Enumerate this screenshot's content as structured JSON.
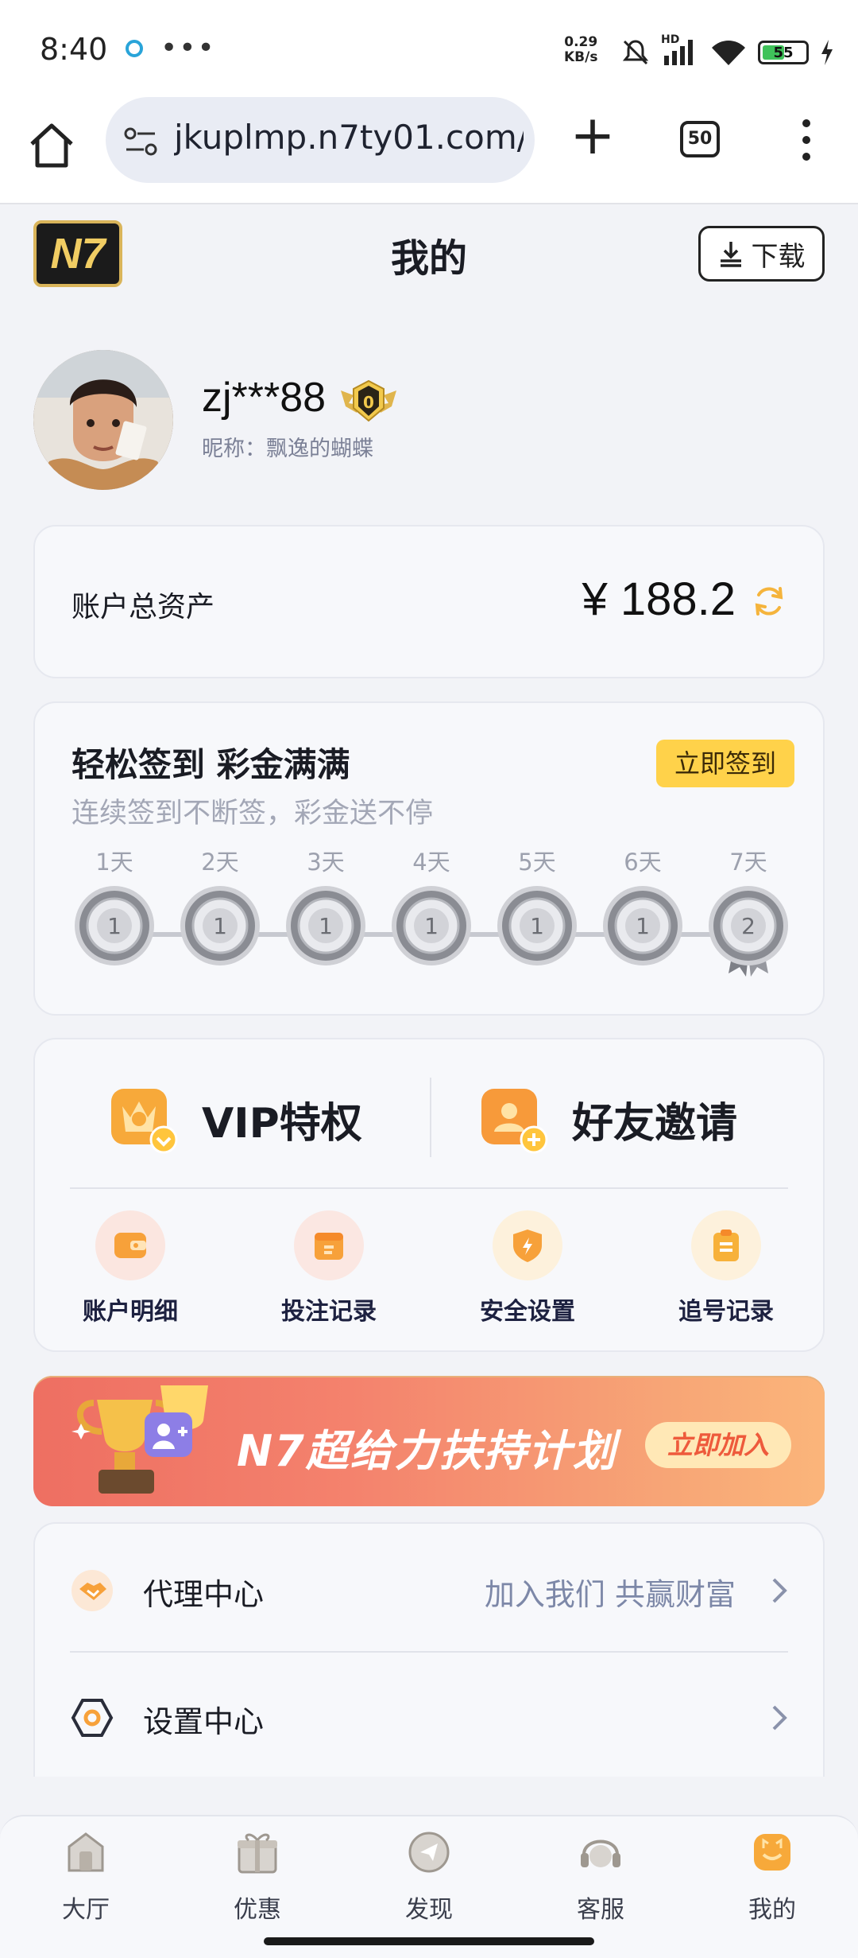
{
  "status_bar": {
    "time": "8:40",
    "more": "•••",
    "net_speed_value": "0.29",
    "net_speed_unit": "KB/s",
    "network_label": "HD",
    "battery": "55"
  },
  "browser": {
    "url": "jkuplmp.n7ty01.com/h",
    "tab_count": "50",
    "new_tab": "+"
  },
  "header": {
    "logo": "N7",
    "title": "我的",
    "download_label": "下载"
  },
  "profile": {
    "username": "zj***88",
    "nickname": "昵称：飘逸的蝴蝶",
    "vip_level": "0"
  },
  "assets": {
    "label": "账户总资产",
    "value": "¥ 188.2"
  },
  "checkin": {
    "title": "轻松签到 彩金满满",
    "subtitle": "连续签到不断签，彩金送不停",
    "button": "立即签到",
    "days": [
      {
        "label": "1天",
        "reward": "1"
      },
      {
        "label": "2天",
        "reward": "1"
      },
      {
        "label": "3天",
        "reward": "1"
      },
      {
        "label": "4天",
        "reward": "1"
      },
      {
        "label": "5天",
        "reward": "1"
      },
      {
        "label": "6天",
        "reward": "1"
      },
      {
        "label": "7天",
        "reward": "2"
      }
    ]
  },
  "menu": {
    "vip": "VIP特权",
    "invite": "好友邀请",
    "items": [
      {
        "label": "账户明细",
        "icon": "wallet-icon"
      },
      {
        "label": "投注记录",
        "icon": "calendar-icon"
      },
      {
        "label": "安全设置",
        "icon": "shield-icon"
      },
      {
        "label": "追号记录",
        "icon": "clipboard-icon"
      }
    ]
  },
  "banner": {
    "title": "N7超给力扶持计划",
    "button": "立即加入"
  },
  "list": {
    "agent_label": "代理中心",
    "agent_extra": "加入我们 共赢财富",
    "settings_label": "设置中心"
  },
  "nav": [
    {
      "label": "大厅",
      "icon": "lobby-icon"
    },
    {
      "label": "优惠",
      "icon": "gift-icon"
    },
    {
      "label": "发现",
      "icon": "discover-icon"
    },
    {
      "label": "客服",
      "icon": "headset-icon"
    },
    {
      "label": "我的",
      "icon": "profile-icon"
    }
  ],
  "colors": {
    "accent": "#ffd24a",
    "brand_orange": "#f5a623",
    "banner": "#ee6f62"
  }
}
